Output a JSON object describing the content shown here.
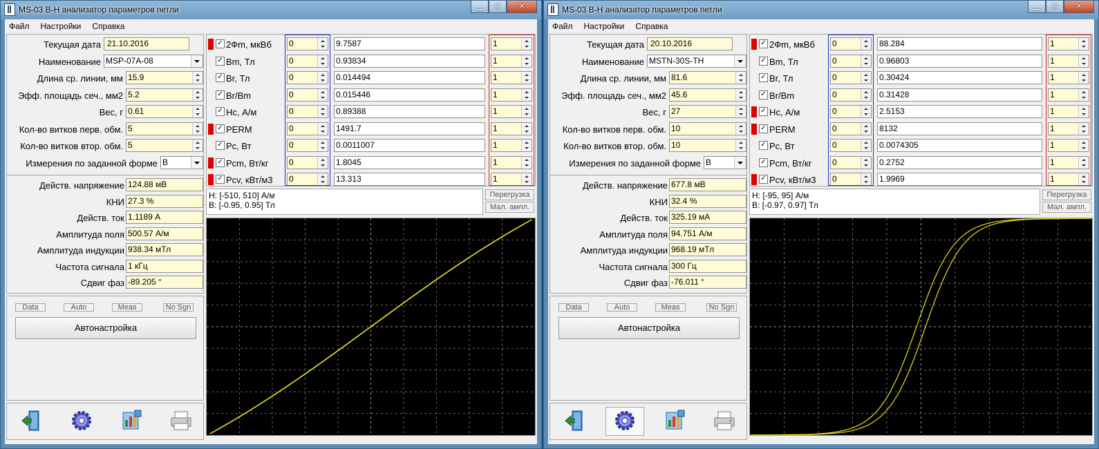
{
  "windows": [
    {
      "title": "MS-03 B-H анализатор параметров петли",
      "menu": [
        "Файл",
        "Настройки",
        "Справка"
      ],
      "fields": [
        {
          "label": "Текущая дата",
          "value": "21.10.2016",
          "kind": "date"
        },
        {
          "label": "Наименование",
          "value": "MSP-07A-08",
          "kind": "combo"
        },
        {
          "label": "Длина ср. линии, мм",
          "value": "15.9",
          "kind": "spin"
        },
        {
          "label": "Эфф. площадь сеч., мм2",
          "value": "5.2",
          "kind": "spin"
        },
        {
          "label": "Вес, г",
          "value": "0.61",
          "kind": "spin"
        },
        {
          "label": "Кол-во витков перв. обм.",
          "value": "5",
          "kind": "spin"
        },
        {
          "label": "Кол-во витков втор. обм.",
          "value": "5",
          "kind": "spin"
        },
        {
          "label": "Измерения по заданной форме",
          "value": "B",
          "kind": "combo-small"
        }
      ],
      "readouts": [
        {
          "label": "Действ. напряжение",
          "value": "124.88 мВ"
        },
        {
          "label": "КНИ",
          "value": "27.3 %"
        },
        {
          "label": "Действ. ток",
          "value": "1.1189 А"
        },
        {
          "label": "Амплитуда поля",
          "value": "500.57 А/м"
        },
        {
          "label": "Амплитуда индукции",
          "value": "938.34 мТл"
        },
        {
          "label": "Частота сигнала",
          "value": "1 кГц"
        },
        {
          "label": "Сдвиг фаз",
          "value": "-89.205 °"
        }
      ],
      "indicators": [
        "Data",
        "Auto",
        "Meas",
        "No Sgn"
      ],
      "autotune_label": "Автонастройка",
      "measurements": [
        {
          "name": "2Фm, мкВб",
          "flag": true,
          "checked": true,
          "offset": "0",
          "value": "9.7587",
          "mult": "1"
        },
        {
          "name": "Bm, Тл",
          "flag": false,
          "checked": true,
          "offset": "0",
          "value": "0.93834",
          "mult": "1"
        },
        {
          "name": "Br, Тл",
          "flag": false,
          "checked": true,
          "offset": "0",
          "value": "0.014494",
          "mult": "1"
        },
        {
          "name": "Br/Bm",
          "flag": false,
          "checked": true,
          "offset": "0",
          "value": "0.015446",
          "mult": "1"
        },
        {
          "name": "Hc, А/м",
          "flag": false,
          "checked": true,
          "offset": "0",
          "value": "0.89388",
          "mult": "1"
        },
        {
          "name": "PERM",
          "flag": true,
          "checked": true,
          "offset": "0",
          "value": "1491.7",
          "mult": "1"
        },
        {
          "name": "Pc, Вт",
          "flag": false,
          "checked": true,
          "offset": "0",
          "value": "0.0011007",
          "mult": "1"
        },
        {
          "name": "Pcm, Вт/кг",
          "flag": true,
          "checked": true,
          "offset": "0",
          "value": "1.8045",
          "mult": "1"
        },
        {
          "name": "Pcv, кВт/м3",
          "flag": true,
          "checked": true,
          "offset": "0",
          "value": "13.313",
          "mult": "1"
        }
      ],
      "range_h": "H: [-510, 510] А/м",
      "range_b": "B: [-0.95, 0.95] Тл",
      "overload_label": "Перегрузка",
      "low_amp_label": "Мал. ампл.",
      "loop": {
        "h_max": 510,
        "b_max": 0.95,
        "hm": 500.57,
        "bm": 0.93834,
        "hc": 0.89388,
        "sat": 0.9,
        "k": 0.55
      },
      "toolbar": [
        "exit-icon",
        "gear-icon",
        "chart-icon",
        "printer-icon"
      ],
      "toolbar_selected": -1
    },
    {
      "title": "MS-03 B-H анализатор параметров петли",
      "menu": [
        "Файл",
        "Настройки",
        "Справка"
      ],
      "fields": [
        {
          "label": "Текущая дата",
          "value": "20.10.2016",
          "kind": "date"
        },
        {
          "label": "Наименование",
          "value": "MSTN-30S-TH",
          "kind": "combo"
        },
        {
          "label": "Длина ср. линии, мм",
          "value": "81.6",
          "kind": "spin"
        },
        {
          "label": "Эфф. площадь сеч., мм2",
          "value": "45.6",
          "kind": "spin"
        },
        {
          "label": "Вес, г",
          "value": "27",
          "kind": "spin"
        },
        {
          "label": "Кол-во витков перв. обм.",
          "value": "10",
          "kind": "spin"
        },
        {
          "label": "Кол-во витков втор. обм.",
          "value": "10",
          "kind": "spin"
        },
        {
          "label": "Измерения по заданной форме",
          "value": "B",
          "kind": "combo-small"
        }
      ],
      "readouts": [
        {
          "label": "Действ. напряжение",
          "value": "677.8 мВ"
        },
        {
          "label": "КНИ",
          "value": "32.4 %"
        },
        {
          "label": "Действ. ток",
          "value": "325.19 мА"
        },
        {
          "label": "Амплитуда поля",
          "value": "94.751 А/м"
        },
        {
          "label": "Амплитуда индукции",
          "value": "968.19 мТл"
        },
        {
          "label": "Частота сигнала",
          "value": "300 Гц"
        },
        {
          "label": "Сдвиг фаз",
          "value": "-76.011 °"
        }
      ],
      "indicators": [
        "Data",
        "Auto",
        "Meas",
        "No Sgn"
      ],
      "autotune_label": "Автонастройка",
      "measurements": [
        {
          "name": "2Фm, мкВб",
          "flag": true,
          "checked": true,
          "offset": "0",
          "value": "88.284",
          "mult": "1"
        },
        {
          "name": "Bm, Тл",
          "flag": false,
          "checked": true,
          "offset": "0",
          "value": "0.96803",
          "mult": "1"
        },
        {
          "name": "Br, Тл",
          "flag": false,
          "checked": true,
          "offset": "0",
          "value": "0.30424",
          "mult": "1"
        },
        {
          "name": "Br/Bm",
          "flag": false,
          "checked": true,
          "offset": "0",
          "value": "0.31428",
          "mult": "1"
        },
        {
          "name": "Hc, А/м",
          "flag": true,
          "checked": true,
          "offset": "0",
          "value": "2.5153",
          "mult": "1"
        },
        {
          "name": "PERM",
          "flag": true,
          "checked": true,
          "offset": "0",
          "value": "8132",
          "mult": "1"
        },
        {
          "name": "Pc, Вт",
          "flag": false,
          "checked": true,
          "offset": "0",
          "value": "0.0074305",
          "mult": "1"
        },
        {
          "name": "Pcm, Вт/кг",
          "flag": false,
          "checked": true,
          "offset": "0",
          "value": "0.2752",
          "mult": "1"
        },
        {
          "name": "Pcv, кВт/м3",
          "flag": true,
          "checked": true,
          "offset": "0",
          "value": "1.9969",
          "mult": "1"
        }
      ],
      "range_h": "H: [-95, 95] А/м",
      "range_b": "B: [-0.97, 0.97] Тл",
      "overload_label": "Перегрузка",
      "low_amp_label": "Мал. ампл.",
      "loop": {
        "h_max": 95,
        "b_max": 0.97,
        "hm": 94.751,
        "bm": 0.96803,
        "hc": 2.5153,
        "sat": 0.93,
        "k": 4.5
      },
      "toolbar": [
        "exit-icon",
        "gear-icon",
        "chart-icon",
        "printer-icon"
      ],
      "toolbar_selected": 1
    }
  ]
}
